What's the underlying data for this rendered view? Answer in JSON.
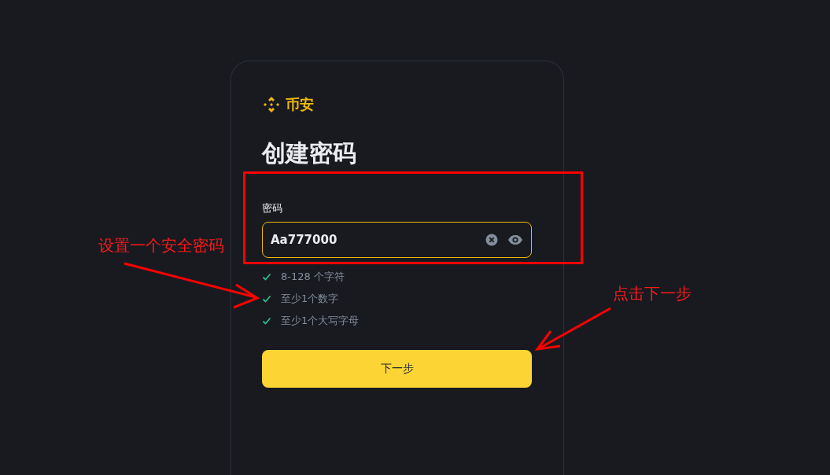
{
  "brand": {
    "name": "币安"
  },
  "title": "创建密码",
  "password_field": {
    "label": "密码",
    "value": "Aa777000",
    "focused": true
  },
  "requirements": [
    {
      "text": "8-128 个字符",
      "met": true
    },
    {
      "text": "至少1个数字",
      "met": true
    },
    {
      "text": "至少1个大写字母",
      "met": true
    }
  ],
  "next_button": {
    "label": "下一步"
  },
  "annotations": [
    {
      "kind": "frame"
    },
    {
      "kind": "callout",
      "text": "设置一个安全密码"
    },
    {
      "kind": "callout",
      "text": "点击下一步"
    }
  ]
}
